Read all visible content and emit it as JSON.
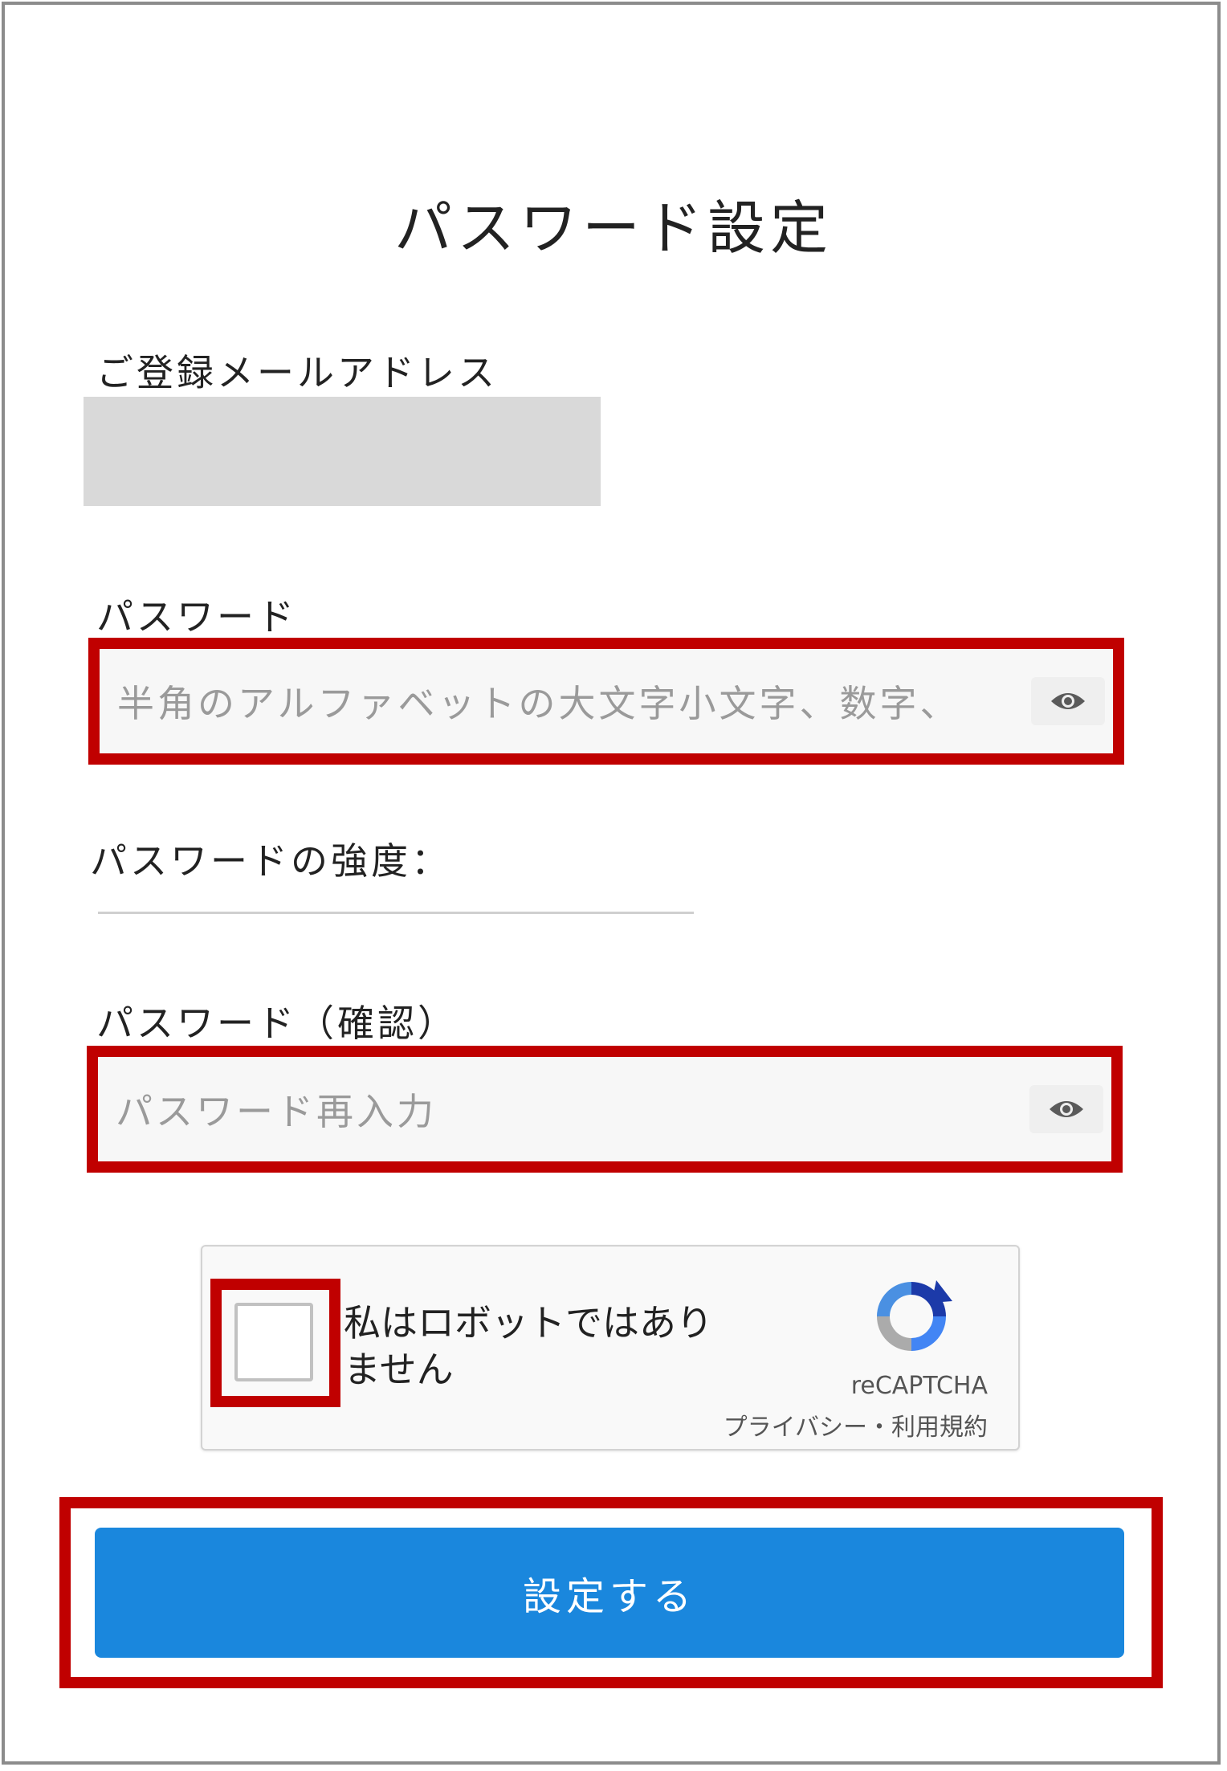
{
  "page_title": "パスワード設定",
  "email": {
    "label": "ご登録メールアドレス",
    "value": ""
  },
  "password": {
    "label": "パスワード",
    "placeholder": "半角のアルファベットの大文字小文字、数字、"
  },
  "strength": {
    "label": "パスワードの強度："
  },
  "password_confirm": {
    "label": "パスワード（確認）",
    "placeholder": "パスワード再入力"
  },
  "captcha": {
    "text": "私はロボットではありません",
    "brand": "reCAPTCHA",
    "links": "プライバシー・利用規約"
  },
  "submit": {
    "label": "設定する"
  },
  "colors": {
    "highlight": "#c00000",
    "button": "#1a87dd"
  }
}
